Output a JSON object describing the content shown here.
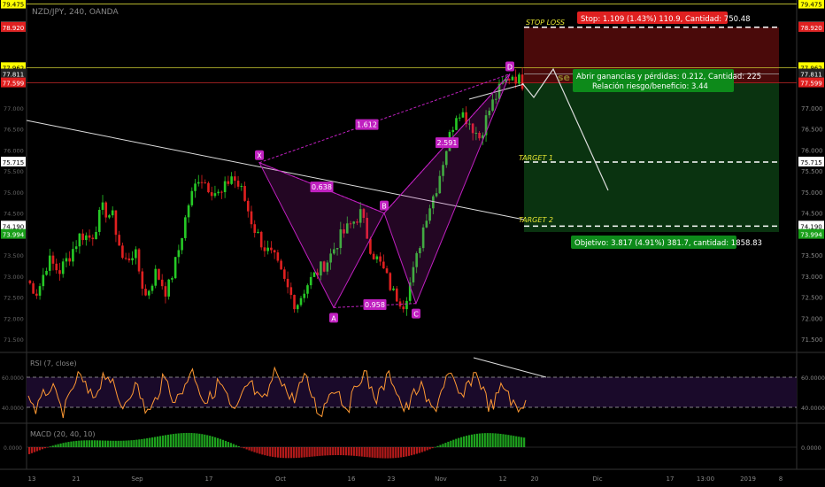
{
  "header": {
    "symbol_line": "NZD/JPY, 240, OANDA"
  },
  "colors": {
    "background": "#000000",
    "bull": "#26c926",
    "bear": "#e02020",
    "pattern": "#c020c0",
    "label_bg": "#c020c0",
    "stop_fill": "#4a0a0a",
    "target_fill": "#0a3310",
    "rsi_line": "#ff9933",
    "rsi_band": "#1a0a2a",
    "yellow_line": "#cccc33",
    "white_line": "#dddddd"
  },
  "main_axis": {
    "ticks": [
      "77.000",
      "76.500",
      "76.000",
      "75.500",
      "75.000",
      "74.500",
      "74.000",
      "73.500",
      "73.000",
      "72.500",
      "72.000",
      "71.500"
    ],
    "left_ticks": [
      "77.000",
      "76.500",
      "76.000",
      "75.500",
      "75.000",
      "74.500",
      "74.000",
      "73.500",
      "73.000",
      "72.500",
      "72.000",
      "71.500"
    ],
    "badges": [
      {
        "value": "79.475",
        "style": "yellow"
      },
      {
        "value": "78.924",
        "style": "white"
      },
      {
        "value": "78.920",
        "style": "red"
      },
      {
        "value": "77.962",
        "style": "yellow"
      },
      {
        "value": "77.811",
        "style": "dark"
      },
      {
        "value": "77.599",
        "style": "red"
      },
      {
        "value": "75.715",
        "style": "white"
      },
      {
        "value": "74.190",
        "style": "white"
      },
      {
        "value": "73.994",
        "style": "green"
      }
    ]
  },
  "x_axis": {
    "labels": [
      "13",
      "21",
      "Sep",
      "17",
      "Oct",
      "16",
      "23",
      "Nov",
      "12",
      "20",
      "Dic",
      "17",
      "13:00",
      "2019",
      "8"
    ]
  },
  "pattern": {
    "points": {
      "X": "X",
      "A": "A",
      "B": "B",
      "C": "C",
      "D": "D"
    },
    "ratios": {
      "xb": "0.638",
      "ac": "0.958",
      "bd": "2.591",
      "xd": "1.612"
    }
  },
  "trade": {
    "stop_label": "STOP LOSS",
    "target1_label": "TARGET 1",
    "target2_label": "TARGET 2",
    "sell_label": "se",
    "stop_info": "Stop: 1.109 (1.43%) 110.9, Cantidad: 750.48",
    "pl_info_line1": "Abrir ganancias y pérdidas: 0.212, Cantidad: 225",
    "pl_info_line2": "Relación riesgo/beneficio: 3.44",
    "target_info": "Objetivo: 3.817 (4.91%) 381.7, cantidad: 1858.83"
  },
  "rsi": {
    "title": "RSI (7, close)",
    "ticks": [
      "60.0000",
      "40.0000"
    ],
    "left_ticks": [
      "60.0000",
      "40.0000"
    ]
  },
  "macd": {
    "title": "MACD (20, 40, 10)",
    "ticks": [
      "0.0000"
    ],
    "left_ticks": [
      "0.0000"
    ]
  },
  "chart_data": {
    "type": "candlestick",
    "title": "NZD/JPY, 240, OANDA",
    "ylim": [
      71.0,
      79.6
    ],
    "pattern_prices": {
      "X": 75.7,
      "A": 72.25,
      "B": 74.5,
      "C": 72.35,
      "D": 77.811
    },
    "levels": {
      "stop": 78.924,
      "entry": 77.811,
      "target1": 75.715,
      "target2": 74.19,
      "yellow_top": 79.475,
      "yellow_mid": 77.962,
      "red_line": 77.599
    },
    "path_waypoints": [
      72.9,
      72.6,
      73.4,
      73.1,
      73.5,
      74.0,
      73.9,
      74.6,
      74.4,
      73.3,
      73.6,
      72.5,
      73.1,
      72.6,
      73.5,
      74.7,
      75.4,
      75.1,
      74.9,
      75.4,
      75.0,
      74.2,
      73.7,
      73.4,
      72.8,
      72.3,
      72.8,
      73.1,
      73.4,
      73.9,
      74.2,
      74.5,
      73.6,
      73.2,
      72.6,
      72.35,
      73.2,
      74.4,
      75.1,
      76.1,
      77.0,
      76.7,
      76.3,
      77.0,
      77.5,
      77.81,
      77.6
    ]
  }
}
